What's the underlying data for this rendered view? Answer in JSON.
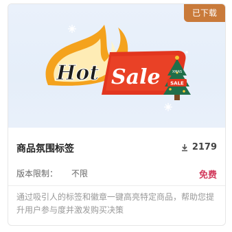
{
  "card": {
    "badge": "已下载",
    "banner": {
      "hot_text": "Hot",
      "sale_text": "Sale",
      "tree_top_text": "XMAS",
      "tree_sale_text": "SALE"
    },
    "title": "商品氛围标签",
    "downloads": "2179",
    "limit_label": "版本限制：",
    "limit_value": "不限",
    "price": "免费",
    "description": "通过吸引人的标签和徽章一键高亮特定商品，帮助您提升用户参与度并激发购买决策"
  },
  "colors": {
    "badge_bg": "#c97a3a",
    "price": "#d23a5c",
    "hot_flame": "#f4a21d",
    "sale_banner": "#e2361f",
    "tree_green": "#1f6f4a"
  }
}
